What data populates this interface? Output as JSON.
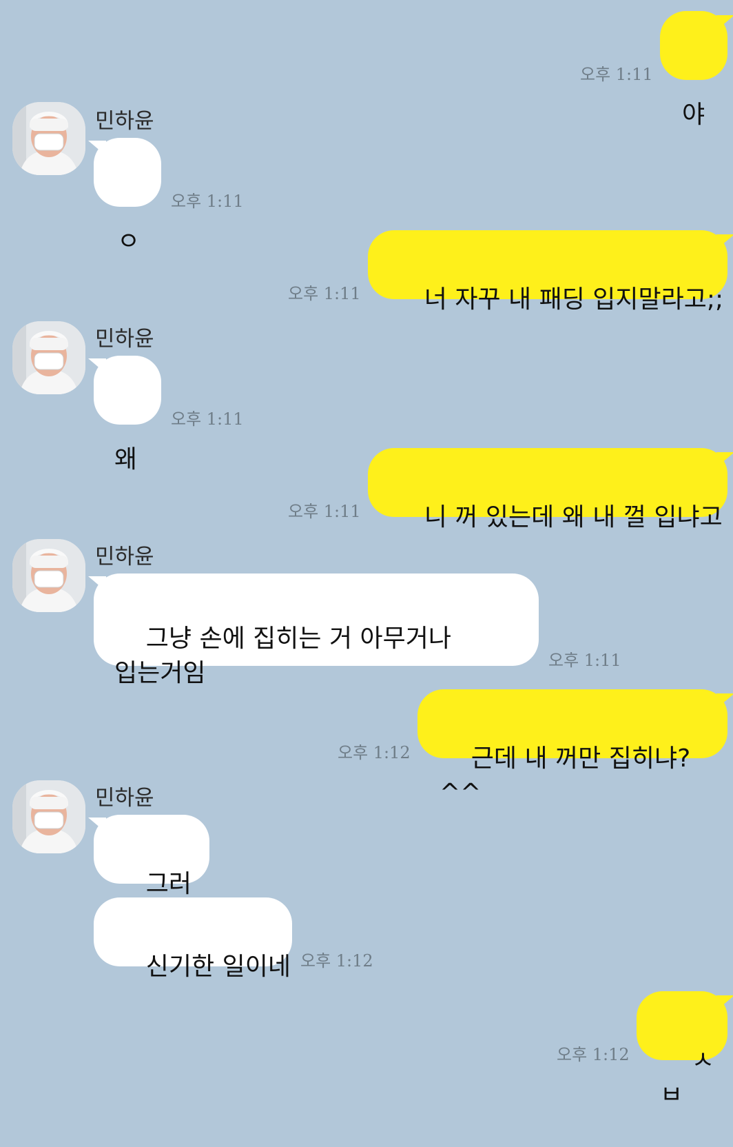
{
  "colors": {
    "background": "#b2c7d9",
    "my_bubble": "#fef01b",
    "their_bubble": "#ffffff",
    "timestamp": "#6f7d88"
  },
  "contact": {
    "name": "민하윤",
    "avatar_icon": "profile-photo-masked-person"
  },
  "messages": [
    {
      "from": "me",
      "text": "야",
      "time": "오후 1:11"
    },
    {
      "from": "them",
      "text": "ㅇ",
      "time": "오후 1:11"
    },
    {
      "from": "me",
      "text": "너 자꾸 내 패딩 입지말라고;;",
      "time": "오후 1:11"
    },
    {
      "from": "them",
      "text": "왜",
      "time": "오후 1:11"
    },
    {
      "from": "me",
      "text": "니 꺼 있는데 왜 내 껄 입냐고",
      "time": "오후 1:11"
    },
    {
      "from": "them",
      "text": "그냥 손에 집히는 거 아무거나\n입는거임",
      "time": "오후 1:11"
    },
    {
      "from": "me",
      "text": "근데 내 꺼만 집히냐? ^^",
      "time": "오후 1:12"
    },
    {
      "from": "them",
      "text": "그러게",
      "time": ""
    },
    {
      "from": "them",
      "text": "신기한 일이네",
      "time": "오후 1:12"
    },
    {
      "from": "me",
      "text": "ㅅㅂ",
      "time": "오후 1:12"
    }
  ]
}
